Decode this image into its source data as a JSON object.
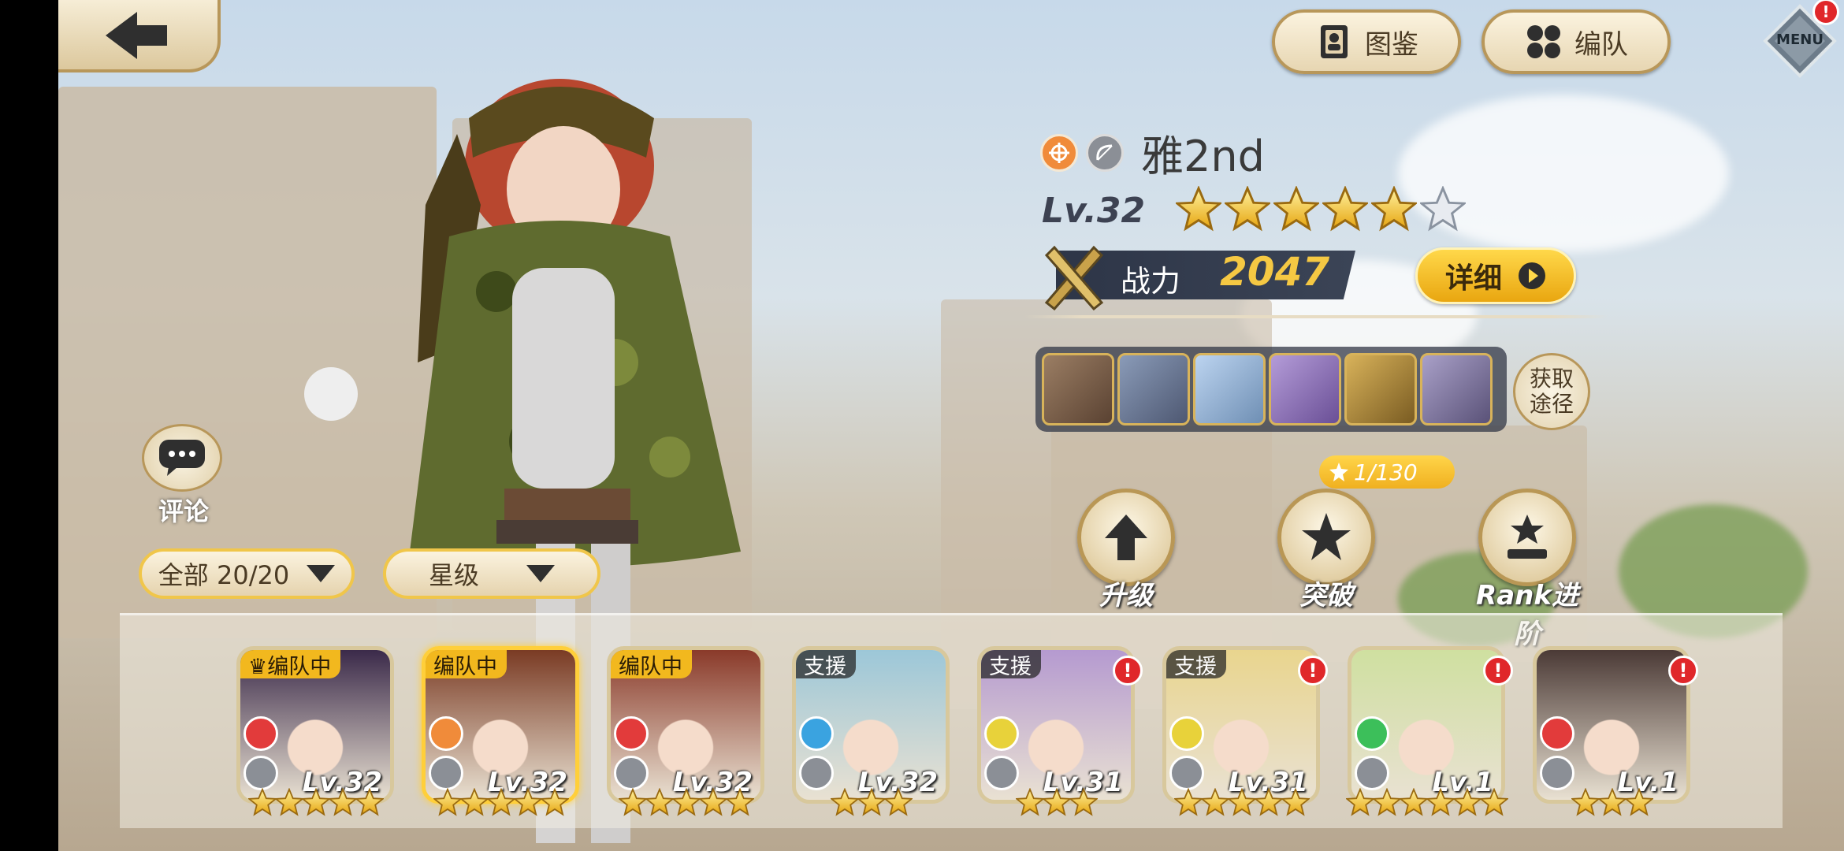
{
  "header": {
    "collection_label": "图鉴",
    "formation_label": "编队",
    "menu_label": "MENU"
  },
  "character": {
    "name": "雅2nd",
    "level": "Lv.32",
    "stars_filled": 5,
    "stars_total": 6,
    "power_label": "战力",
    "power_value": "2047",
    "detail_label": "详细",
    "obtain_label_line1": "获取",
    "obtain_label_line2": "途径",
    "shard_counter": "1/130"
  },
  "actions": {
    "upgrade": "升级",
    "breakthrough": "突破",
    "rank": "Rank进阶"
  },
  "side": {
    "comment_label": "评论",
    "filter_all": "全部 20/20",
    "filter_star": "星级"
  },
  "roster": [
    {
      "tag": "编队中",
      "level": "Lv.32",
      "stars": 5,
      "element": "fire",
      "role": "sword",
      "color": "#3b2a4a",
      "crown": true
    },
    {
      "tag": "编队中",
      "level": "Lv.32",
      "stars": 5,
      "element": "orange",
      "role": "bow",
      "color": "#7a3b24",
      "crown": false
    },
    {
      "tag": "编队中",
      "level": "Lv.32",
      "stars": 5,
      "element": "fire",
      "role": "sword",
      "color": "#8a3a2a",
      "crown": false
    },
    {
      "tag": "支援",
      "level": "Lv.32",
      "stars": 3,
      "element": "water",
      "role": "sword",
      "color": "#9cc7d8",
      "crown": false
    },
    {
      "tag": "支援",
      "level": "Lv.31",
      "stars": 3,
      "element": "light",
      "role": "staff",
      "color": "#b59ad0",
      "crown": false
    },
    {
      "tag": "支援",
      "level": "Lv.31",
      "stars": 5,
      "element": "light",
      "role": "staff",
      "color": "#e9d58e",
      "crown": false
    },
    {
      "tag": "",
      "level": "Lv.1",
      "stars": 6,
      "element": "wind",
      "role": "bow",
      "color": "#cfe0a0",
      "crown": false
    },
    {
      "tag": "",
      "level": "Lv.1",
      "stars": 3,
      "element": "fire",
      "role": "sword",
      "color": "#4b3a36",
      "crown": false
    }
  ],
  "colors": {
    "gold": "#f5c843",
    "frame": "#b8975a",
    "alert": "#e0272a"
  }
}
